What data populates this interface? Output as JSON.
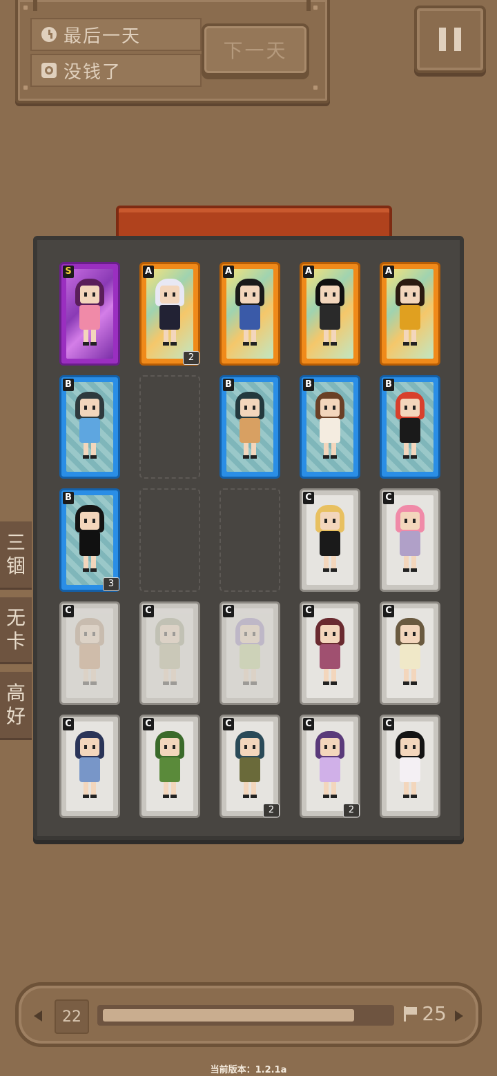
{
  "status": {
    "day_text": "最后一天",
    "money_text": "没钱了",
    "next_day_label": "下一天"
  },
  "side_tabs": [
    {
      "label": "三\n锢"
    },
    {
      "label": "无\n卡"
    },
    {
      "label": "高\n好"
    }
  ],
  "cards": [
    {
      "rank": "S",
      "count": "",
      "hair": "#5a1e5a",
      "outfit": "#f08aa8"
    },
    {
      "rank": "A",
      "count": "2",
      "hair": "#e8e8f4",
      "outfit": "#222234"
    },
    {
      "rank": "A",
      "count": "",
      "hair": "#1a1a1a",
      "outfit": "#3a5aa8"
    },
    {
      "rank": "A",
      "count": "",
      "hair": "#111111",
      "outfit": "#2a2a2a"
    },
    {
      "rank": "A",
      "count": "",
      "hair": "#2a1a10",
      "outfit": "#e0a020"
    },
    {
      "rank": "B",
      "count": "",
      "hair": "#2e3a3e",
      "outfit": "#5ea6e0"
    },
    null,
    {
      "rank": "B",
      "count": "",
      "hair": "#23393e",
      "outfit": "#d8a062"
    },
    {
      "rank": "B",
      "count": "",
      "hair": "#6a4026",
      "outfit": "#f4ece0"
    },
    {
      "rank": "B",
      "count": "",
      "hair": "#d8402c",
      "outfit": "#1a1a1a"
    },
    {
      "rank": "B",
      "count": "3",
      "hair": "#141414",
      "outfit": "#111111"
    },
    null,
    null,
    {
      "rank": "C",
      "count": "",
      "hair": "#e8c060",
      "outfit": "#1a1a1a"
    },
    {
      "rank": "C",
      "count": "",
      "hair": "#f08aa8",
      "outfit": "#b0a0c8"
    },
    {
      "rank": "C",
      "count": "",
      "hair": "#b09070",
      "outfit": "#c89060",
      "faded": true
    },
    {
      "rank": "C",
      "count": "",
      "hair": "#98a080",
      "outfit": "#b8b890",
      "faded": true
    },
    {
      "rank": "C",
      "count": "",
      "hair": "#9080c0",
      "outfit": "#c0d890",
      "faded": true
    },
    {
      "rank": "C",
      "count": "",
      "hair": "#6a2a30",
      "outfit": "#a05070"
    },
    {
      "rank": "C",
      "count": "",
      "hair": "#6a5a40",
      "outfit": "#f0e8c8"
    },
    {
      "rank": "C",
      "count": "",
      "hair": "#2a3458",
      "outfit": "#7896c8"
    },
    {
      "rank": "C",
      "count": "",
      "hair": "#3a6a2a",
      "outfit": "#5a8a3a"
    },
    {
      "rank": "C",
      "count": "2",
      "hair": "#2a4a58",
      "outfit": "#6a6a3a"
    },
    {
      "rank": "C",
      "count": "2",
      "hair": "#5a3a7a",
      "outfit": "#d0b0e8"
    },
    {
      "rank": "C",
      "count": "",
      "hair": "#141414",
      "outfit": "#f4f0f4"
    }
  ],
  "progress": {
    "current_day": "22",
    "goal_day": "25",
    "fraction": 0.88
  },
  "version_text": "当前版本：1.2.1a"
}
